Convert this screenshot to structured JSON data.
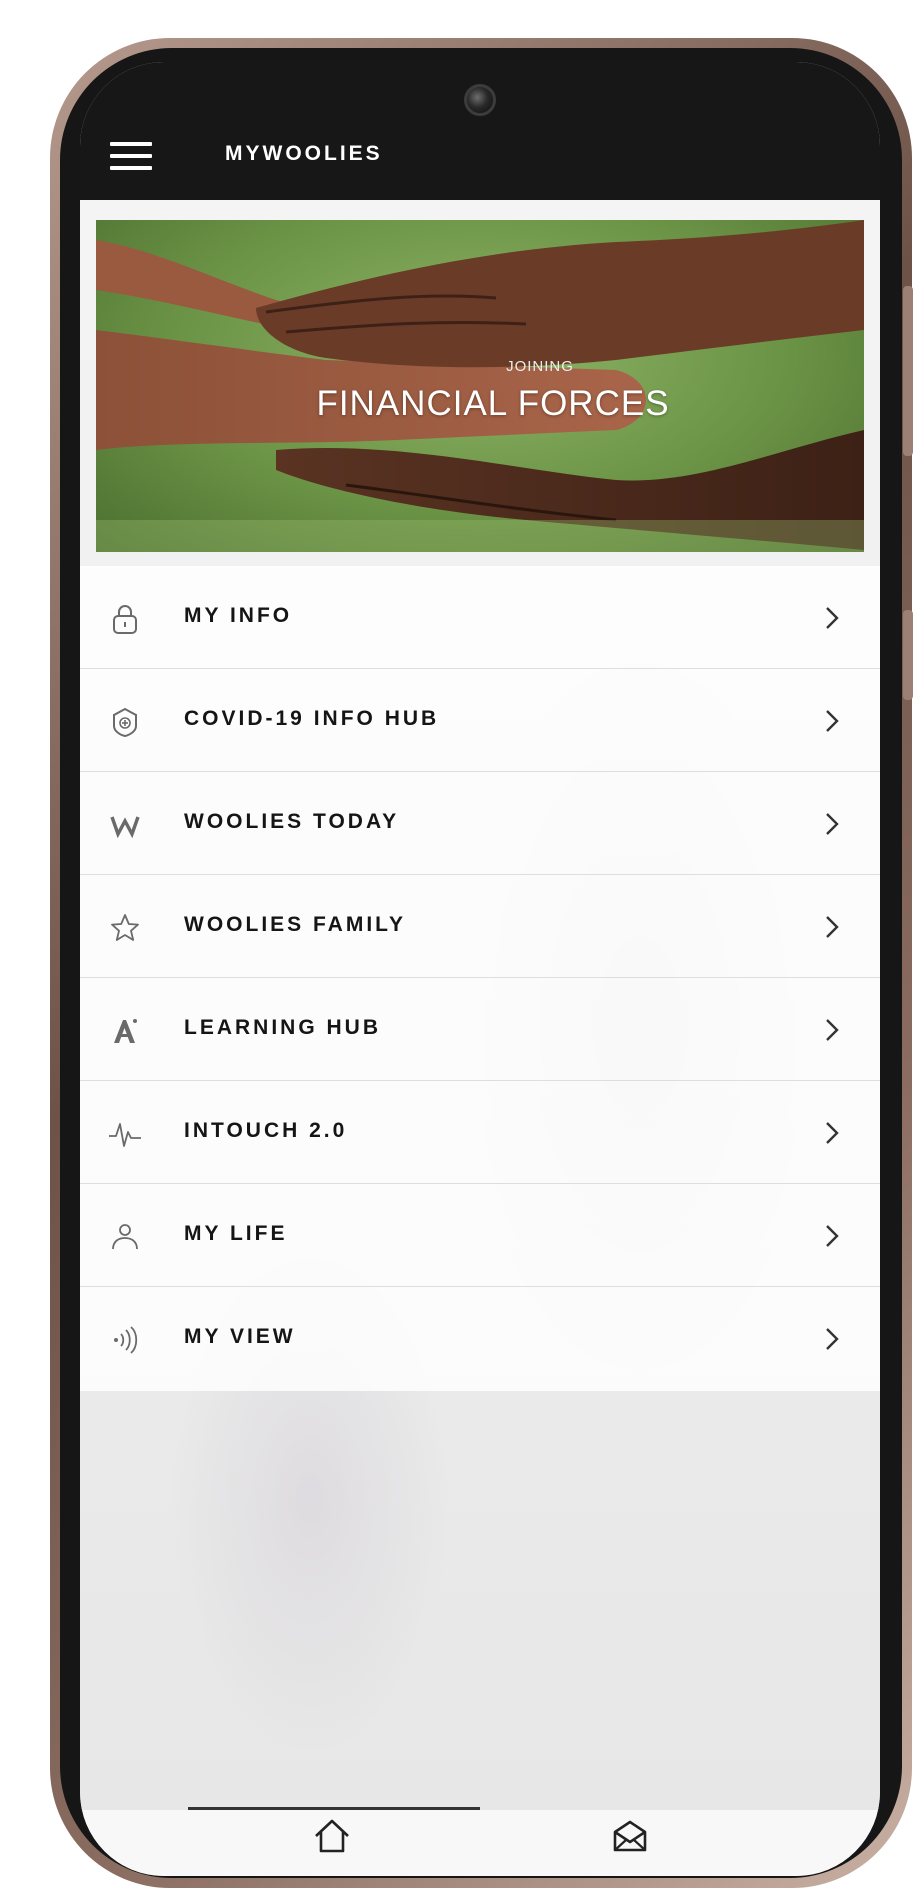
{
  "app": {
    "title": "MYWOOLIES"
  },
  "banner": {
    "subtitle": "JOINING",
    "title": "FINANCIAL FORCES"
  },
  "menu": {
    "items": [
      {
        "label": "MY INFO",
        "icon": "lock-icon"
      },
      {
        "label": "COVID-19 INFO HUB",
        "icon": "shield-plus-icon"
      },
      {
        "label": "WOOLIES TODAY",
        "icon": "w-logo-icon"
      },
      {
        "label": "WOOLIES FAMILY",
        "icon": "star-icon"
      },
      {
        "label": "LEARNING HUB",
        "icon": "learning-a-icon"
      },
      {
        "label": "INTOUCH 2.0",
        "icon": "pulse-icon"
      },
      {
        "label": "MY LIFE",
        "icon": "person-icon"
      },
      {
        "label": "MY VIEW",
        "icon": "broadcast-icon"
      }
    ]
  },
  "bottom_nav": {
    "items": [
      "home-icon",
      "mail-icon"
    ]
  },
  "colors": {
    "app_bar": "#171717",
    "frame": "#8a6c60",
    "text": "#151515"
  }
}
